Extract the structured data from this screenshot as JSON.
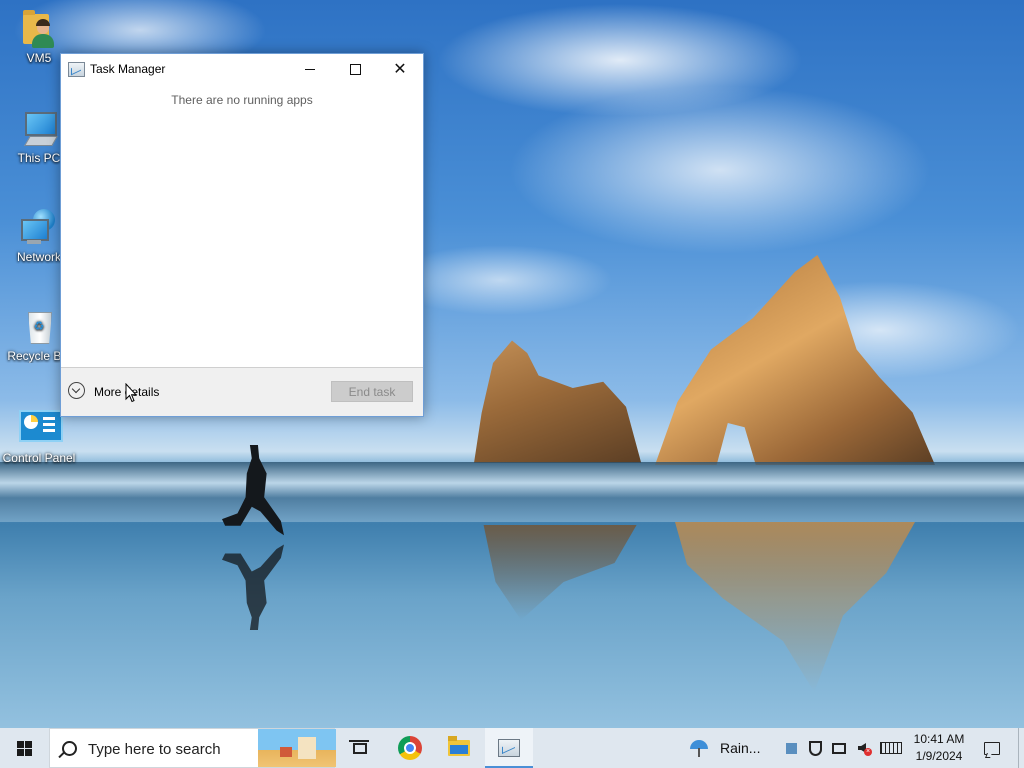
{
  "desktop": {
    "icons": [
      {
        "label": "VM5",
        "icon": "user-folder-icon"
      },
      {
        "label": "This PC",
        "icon": "computer-icon"
      },
      {
        "label": "Network",
        "icon": "network-icon"
      },
      {
        "label": "Recycle Bin",
        "icon": "recycle-bin-icon"
      },
      {
        "label": "Control Panel",
        "icon": "control-panel-icon"
      }
    ]
  },
  "task_manager": {
    "title": "Task Manager",
    "empty_message": "There are no running apps",
    "more_details_label": "More details",
    "end_task_label": "End task",
    "close_glyph": "✕"
  },
  "taskbar": {
    "search_placeholder": "Type here to search",
    "pinned": [
      "chrome-icon",
      "file-explorer-icon",
      "task-manager-icon"
    ],
    "weather_label": "Rain...",
    "clock_time": "10:41 AM",
    "clock_date": "1/9/2024"
  },
  "colors": {
    "accent": "#4a8fd6",
    "taskbar_bg": "#dfe7ef",
    "end_task_disabled_bg": "#cccccc"
  }
}
